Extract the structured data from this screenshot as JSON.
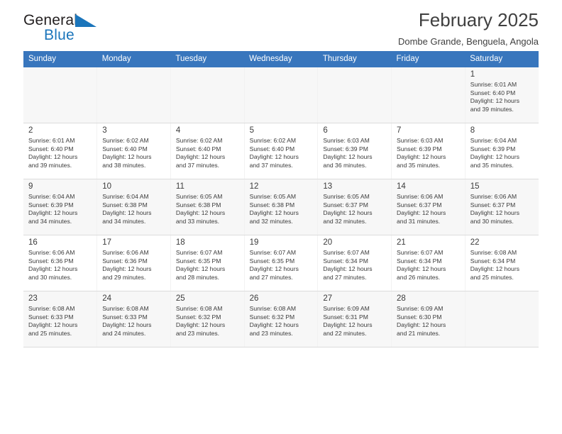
{
  "brand": {
    "word_one": "General",
    "word_two": "Blue",
    "logo_icon": "blue-triangle-icon",
    "accent_color": "#1b75bb"
  },
  "header": {
    "title": "February 2025",
    "location": "Dombe Grande, Benguela, Angola"
  },
  "calendar": {
    "header_bg": "#3876bd",
    "weekday_headers": [
      "Sunday",
      "Monday",
      "Tuesday",
      "Wednesday",
      "Thursday",
      "Friday",
      "Saturday"
    ],
    "labels": {
      "sunrise": "Sunrise:",
      "sunset": "Sunset:",
      "daylight": "Daylight:"
    },
    "weeks": [
      [
        {
          "day": "",
          "empty": true
        },
        {
          "day": "",
          "empty": true
        },
        {
          "day": "",
          "empty": true
        },
        {
          "day": "",
          "empty": true
        },
        {
          "day": "",
          "empty": true
        },
        {
          "day": "",
          "empty": true
        },
        {
          "day": "1",
          "sunrise": "Sunrise: 6:01 AM",
          "sunset": "Sunset: 6:40 PM",
          "daylight_line1": "Daylight: 12 hours",
          "daylight_line2": "and 39 minutes."
        }
      ],
      [
        {
          "day": "2",
          "sunrise": "Sunrise: 6:01 AM",
          "sunset": "Sunset: 6:40 PM",
          "daylight_line1": "Daylight: 12 hours",
          "daylight_line2": "and 39 minutes."
        },
        {
          "day": "3",
          "sunrise": "Sunrise: 6:02 AM",
          "sunset": "Sunset: 6:40 PM",
          "daylight_line1": "Daylight: 12 hours",
          "daylight_line2": "and 38 minutes."
        },
        {
          "day": "4",
          "sunrise": "Sunrise: 6:02 AM",
          "sunset": "Sunset: 6:40 PM",
          "daylight_line1": "Daylight: 12 hours",
          "daylight_line2": "and 37 minutes."
        },
        {
          "day": "5",
          "sunrise": "Sunrise: 6:02 AM",
          "sunset": "Sunset: 6:40 PM",
          "daylight_line1": "Daylight: 12 hours",
          "daylight_line2": "and 37 minutes."
        },
        {
          "day": "6",
          "sunrise": "Sunrise: 6:03 AM",
          "sunset": "Sunset: 6:39 PM",
          "daylight_line1": "Daylight: 12 hours",
          "daylight_line2": "and 36 minutes."
        },
        {
          "day": "7",
          "sunrise": "Sunrise: 6:03 AM",
          "sunset": "Sunset: 6:39 PM",
          "daylight_line1": "Daylight: 12 hours",
          "daylight_line2": "and 35 minutes."
        },
        {
          "day": "8",
          "sunrise": "Sunrise: 6:04 AM",
          "sunset": "Sunset: 6:39 PM",
          "daylight_line1": "Daylight: 12 hours",
          "daylight_line2": "and 35 minutes."
        }
      ],
      [
        {
          "day": "9",
          "sunrise": "Sunrise: 6:04 AM",
          "sunset": "Sunset: 6:39 PM",
          "daylight_line1": "Daylight: 12 hours",
          "daylight_line2": "and 34 minutes."
        },
        {
          "day": "10",
          "sunrise": "Sunrise: 6:04 AM",
          "sunset": "Sunset: 6:38 PM",
          "daylight_line1": "Daylight: 12 hours",
          "daylight_line2": "and 34 minutes."
        },
        {
          "day": "11",
          "sunrise": "Sunrise: 6:05 AM",
          "sunset": "Sunset: 6:38 PM",
          "daylight_line1": "Daylight: 12 hours",
          "daylight_line2": "and 33 minutes."
        },
        {
          "day": "12",
          "sunrise": "Sunrise: 6:05 AM",
          "sunset": "Sunset: 6:38 PM",
          "daylight_line1": "Daylight: 12 hours",
          "daylight_line2": "and 32 minutes."
        },
        {
          "day": "13",
          "sunrise": "Sunrise: 6:05 AM",
          "sunset": "Sunset: 6:37 PM",
          "daylight_line1": "Daylight: 12 hours",
          "daylight_line2": "and 32 minutes."
        },
        {
          "day": "14",
          "sunrise": "Sunrise: 6:06 AM",
          "sunset": "Sunset: 6:37 PM",
          "daylight_line1": "Daylight: 12 hours",
          "daylight_line2": "and 31 minutes."
        },
        {
          "day": "15",
          "sunrise": "Sunrise: 6:06 AM",
          "sunset": "Sunset: 6:37 PM",
          "daylight_line1": "Daylight: 12 hours",
          "daylight_line2": "and 30 minutes."
        }
      ],
      [
        {
          "day": "16",
          "sunrise": "Sunrise: 6:06 AM",
          "sunset": "Sunset: 6:36 PM",
          "daylight_line1": "Daylight: 12 hours",
          "daylight_line2": "and 30 minutes."
        },
        {
          "day": "17",
          "sunrise": "Sunrise: 6:06 AM",
          "sunset": "Sunset: 6:36 PM",
          "daylight_line1": "Daylight: 12 hours",
          "daylight_line2": "and 29 minutes."
        },
        {
          "day": "18",
          "sunrise": "Sunrise: 6:07 AM",
          "sunset": "Sunset: 6:35 PM",
          "daylight_line1": "Daylight: 12 hours",
          "daylight_line2": "and 28 minutes."
        },
        {
          "day": "19",
          "sunrise": "Sunrise: 6:07 AM",
          "sunset": "Sunset: 6:35 PM",
          "daylight_line1": "Daylight: 12 hours",
          "daylight_line2": "and 27 minutes."
        },
        {
          "day": "20",
          "sunrise": "Sunrise: 6:07 AM",
          "sunset": "Sunset: 6:34 PM",
          "daylight_line1": "Daylight: 12 hours",
          "daylight_line2": "and 27 minutes."
        },
        {
          "day": "21",
          "sunrise": "Sunrise: 6:07 AM",
          "sunset": "Sunset: 6:34 PM",
          "daylight_line1": "Daylight: 12 hours",
          "daylight_line2": "and 26 minutes."
        },
        {
          "day": "22",
          "sunrise": "Sunrise: 6:08 AM",
          "sunset": "Sunset: 6:34 PM",
          "daylight_line1": "Daylight: 12 hours",
          "daylight_line2": "and 25 minutes."
        }
      ],
      [
        {
          "day": "23",
          "sunrise": "Sunrise: 6:08 AM",
          "sunset": "Sunset: 6:33 PM",
          "daylight_line1": "Daylight: 12 hours",
          "daylight_line2": "and 25 minutes."
        },
        {
          "day": "24",
          "sunrise": "Sunrise: 6:08 AM",
          "sunset": "Sunset: 6:33 PM",
          "daylight_line1": "Daylight: 12 hours",
          "daylight_line2": "and 24 minutes."
        },
        {
          "day": "25",
          "sunrise": "Sunrise: 6:08 AM",
          "sunset": "Sunset: 6:32 PM",
          "daylight_line1": "Daylight: 12 hours",
          "daylight_line2": "and 23 minutes."
        },
        {
          "day": "26",
          "sunrise": "Sunrise: 6:08 AM",
          "sunset": "Sunset: 6:32 PM",
          "daylight_line1": "Daylight: 12 hours",
          "daylight_line2": "and 23 minutes."
        },
        {
          "day": "27",
          "sunrise": "Sunrise: 6:09 AM",
          "sunset": "Sunset: 6:31 PM",
          "daylight_line1": "Daylight: 12 hours",
          "daylight_line2": "and 22 minutes."
        },
        {
          "day": "28",
          "sunrise": "Sunrise: 6:09 AM",
          "sunset": "Sunset: 6:30 PM",
          "daylight_line1": "Daylight: 12 hours",
          "daylight_line2": "and 21 minutes."
        },
        {
          "day": "",
          "empty": true
        }
      ]
    ]
  }
}
